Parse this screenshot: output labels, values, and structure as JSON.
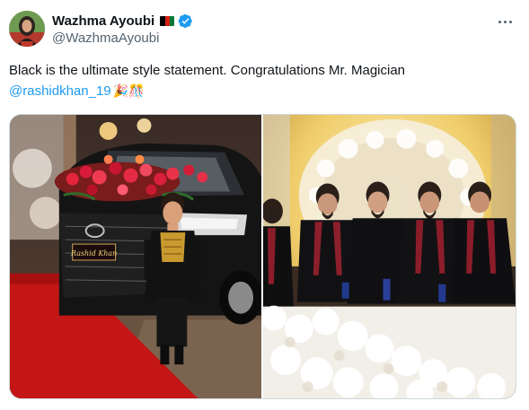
{
  "author": {
    "display_name": "Wazhma Ayoubi",
    "handle": "@WazhmaAyoubi",
    "flag_icon": "afghanistan-flag-icon",
    "verified_icon": "verified-badge-icon",
    "verified_color": "#1d9bf0"
  },
  "tweet": {
    "text_line1": "Black is the ultimate style statement. Congratulations Mr. Magician",
    "mention": "@rashidkhan_19",
    "emojis": "🎉🎊"
  },
  "media": {
    "images": [
      {
        "plate_text": "Rashid Khan"
      },
      {}
    ]
  },
  "colors": {
    "link": "#1d9bf0",
    "secondary_text": "#536471",
    "border": "#cfd9de"
  }
}
